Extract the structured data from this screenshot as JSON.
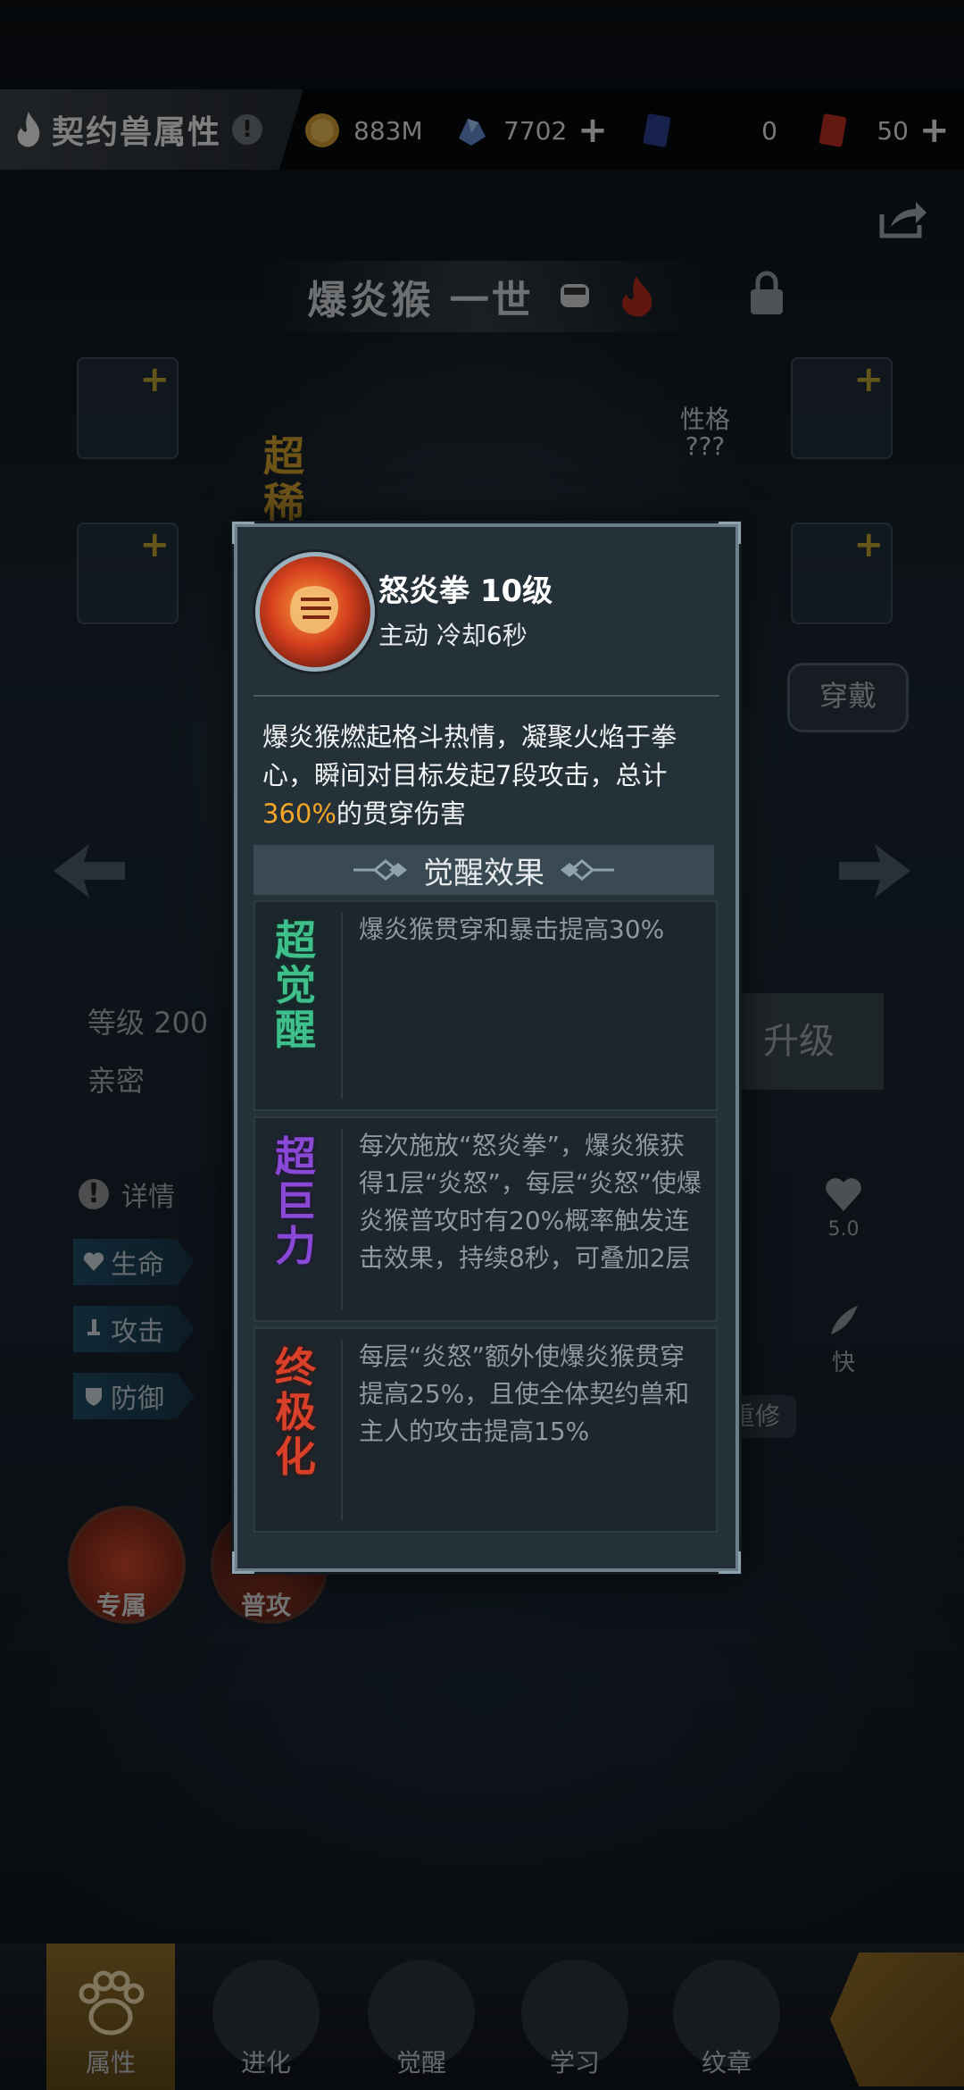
{
  "header": {
    "title": "契约兽属性",
    "info_badge": "!",
    "resources": [
      {
        "icon": "gold-coin-icon",
        "value": "883M"
      },
      {
        "icon": "blue-crystal-icon",
        "value": "7702"
      },
      {
        "icon": "card-ticket-icon",
        "value": "0"
      },
      {
        "icon": "gold-card-ticket-icon",
        "value": "50"
      }
    ]
  },
  "pet": {
    "name": "爆炎猴 一世",
    "rarity_label": "超稀",
    "personality_label": "性格",
    "personality_value": "???",
    "equip_button": "穿戴",
    "level_label": "等级 200",
    "intimacy_label": "亲密",
    "upgrade_button": "升级",
    "details_label": "详情",
    "stats": [
      "生命",
      "攻击",
      "防御"
    ],
    "speed_value": "5.0",
    "speed_label": "快",
    "retrain_button": "重修",
    "skill_tabs": [
      "专属",
      "普攻"
    ]
  },
  "popup": {
    "skill_name": "怒炎拳 10级",
    "skill_meta": "主动  冷却6秒",
    "desc_before": "爆炎猴燃起格斗热情，凝聚火焰于拳心，瞬间对目标发起7段攻击，总计",
    "desc_highlight": "360%",
    "desc_after": "的贯穿伤害",
    "awaken_title": "觉醒效果",
    "effects": [
      {
        "badge": "超觉醒",
        "text": "爆炎猴贯穿和暴击提高30%"
      },
      {
        "badge": "超巨力",
        "text": "每次施放“怒炎拳”，爆炎猴获得1层“炎怒”，每层“炎怒”使爆炎猴普攻时有20%概率触发连击效果，持续8秒，可叠加2层"
      },
      {
        "badge": "终极化",
        "text": "每层“炎怒”额外使爆炎猴贯穿提高25%，且使全体契约兽和主人的攻击提高15%"
      }
    ]
  },
  "nav": {
    "items": [
      "属性",
      "进化",
      "觉醒",
      "学习",
      "纹章"
    ]
  },
  "colors": {
    "highlight": "#f3a628",
    "badge_green": "#3fbf8a",
    "badge_purple": "#8a48d6",
    "badge_red": "#d8402a"
  }
}
